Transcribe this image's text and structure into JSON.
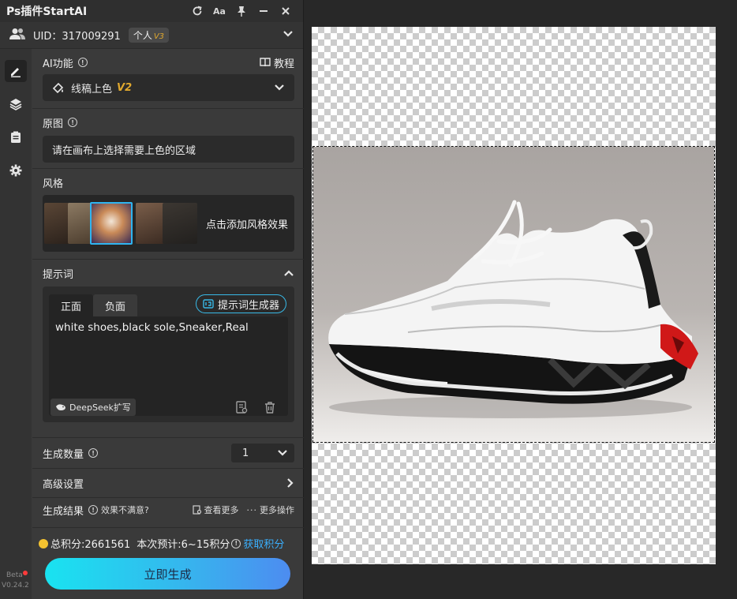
{
  "window": {
    "title": "Ps插件StartAI",
    "buttons": {
      "refresh": "refresh-icon",
      "font": "Aa",
      "pin": "pin-icon",
      "minimize": "minimize-icon",
      "close": "close-icon"
    }
  },
  "account": {
    "uid": "UID：317009291",
    "plan": "个人",
    "plan_version": "V3"
  },
  "sidebar": {
    "items": [
      "edit-icon",
      "layers-icon",
      "clipboard-icon",
      "gear-icon"
    ],
    "beta": "Beta",
    "version": "V0.24.2"
  },
  "ai_function": {
    "label": "AI功能",
    "tutorial": "教程",
    "selected": "线稿上色",
    "selected_version": "V2"
  },
  "source_image": {
    "label": "原图",
    "placeholder": "请在画布上选择需要上色的区域"
  },
  "style": {
    "label": "风格",
    "add_text": "点击添加风格效果"
  },
  "prompt": {
    "label": "提示词",
    "tabs": [
      "正面",
      "负面"
    ],
    "generator_button": "提示词生成器",
    "text": "white shoes,black sole,Sneaker,Real",
    "deepseek_button": "DeepSeek扩写"
  },
  "quantity": {
    "label": "生成数量",
    "value": "1"
  },
  "advanced": {
    "label": "高级设置"
  },
  "results": {
    "label": "生成结果",
    "unsatisfied": "效果不满意?",
    "view_more": "查看更多",
    "more_actions": "更多操作"
  },
  "points": {
    "total": "总积分:2661561",
    "estimate": "本次预计:6~15积分",
    "get": "获取积分"
  },
  "submit": {
    "label": "立即生成"
  },
  "colors": {
    "accent": "#38b8e6",
    "link": "#3ab0ff",
    "coin": "#f3c230",
    "badge": "#e0a82e"
  }
}
